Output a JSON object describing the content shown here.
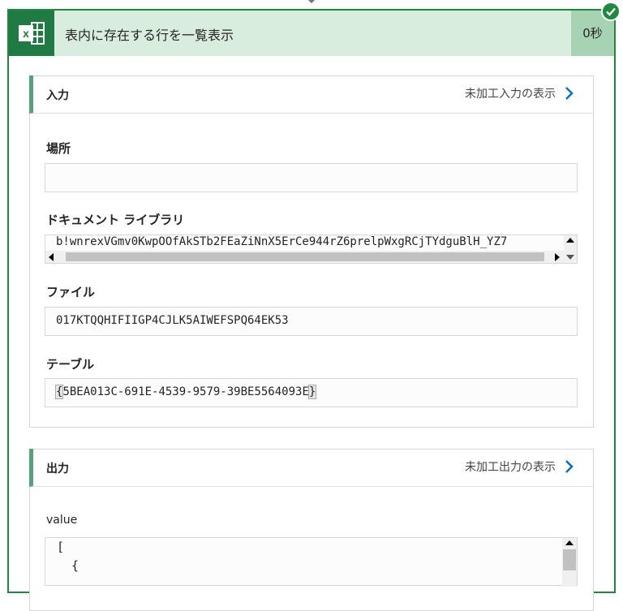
{
  "action": {
    "title": "表内に存在する行を一覧表示",
    "duration": "0秒",
    "status": "succeeded",
    "icon": "excel-icon"
  },
  "inputs": {
    "section_title": "入力",
    "raw_link": "未加工入力の表示",
    "fields": {
      "location_label": "場所",
      "location_value": "",
      "library_label": "ドキュメント ライブラリ",
      "library_value": "b!wnrexVGmv0KwpOOfAkSTb2FEaZiNnX5ErCe944rZ6prelpWxgRCjTYdguBlH_YZ7",
      "file_label": "ファイル",
      "file_value": "017KTQQHIFIIGP4CJLK5AIWEFSPQ64EK53",
      "table_label": "テーブル",
      "table_brace_open": "{",
      "table_value": "5BEA013C-691E-4539-9579-39BE5564093E",
      "table_brace_close": "}"
    }
  },
  "outputs": {
    "section_title": "出力",
    "raw_link": "未加工出力の表示",
    "value_label": "value",
    "value_lines": [
      "[",
      "  {"
    ]
  },
  "colors": {
    "accent_green": "#21893f",
    "header_bg": "#d9eddf",
    "duration_bg": "#a7d3b4",
    "link_chevron": "#0f6cbd"
  }
}
